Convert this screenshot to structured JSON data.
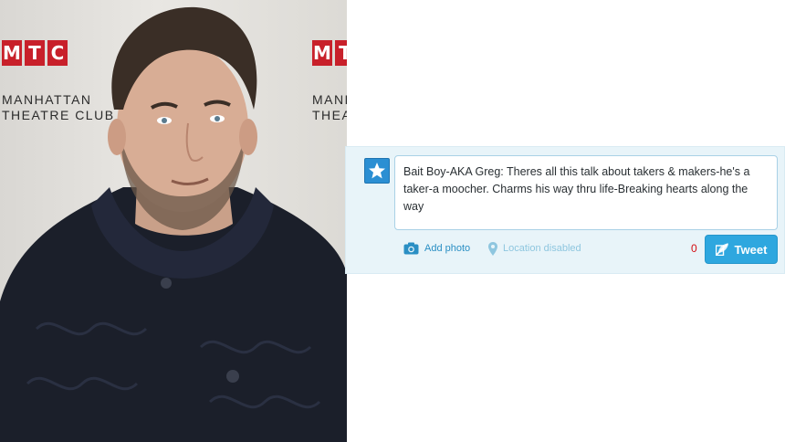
{
  "backdrop": {
    "logo_letters": [
      "M",
      "T",
      "C"
    ],
    "line1": "MANHATTAN",
    "line2": "THEATRE CLUB",
    "logo_color": "#c8202a"
  },
  "photo": {
    "subject": "man-in-dark-sweater"
  },
  "composer": {
    "avatar_icon": "star-icon",
    "tweet_text": "Bait Boy-AKA Greg: Theres all this talk about takers & makers-he's a taker-a moocher. Charms his way thru life-Breaking hearts along the way",
    "add_photo_label": "Add photo",
    "add_photo_icon": "camera-icon",
    "location_label": "Location disabled",
    "location_icon": "location-pin-icon",
    "char_count": "0",
    "tweet_button_label": "Tweet",
    "tweet_button_icon": "quill-icon",
    "accent_color": "#2ea7df",
    "count_color": "#d40d12"
  }
}
